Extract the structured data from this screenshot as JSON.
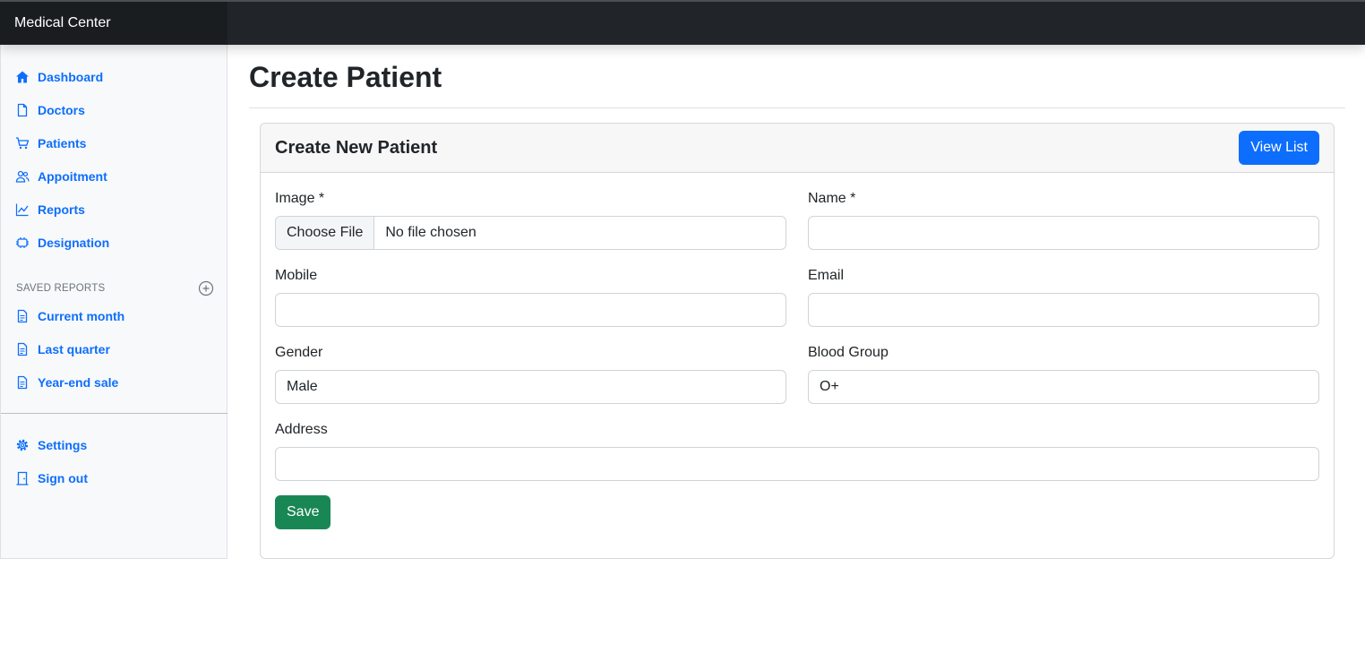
{
  "app": {
    "brand": "Medical Center"
  },
  "sidebar": {
    "items": [
      {
        "label": "Dashboard",
        "icon": "home-icon"
      },
      {
        "label": "Doctors",
        "icon": "file-icon"
      },
      {
        "label": "Patients",
        "icon": "shopping-cart-icon"
      },
      {
        "label": "Appoitment",
        "icon": "users-icon"
      },
      {
        "label": "Reports",
        "icon": "bar-chart-icon"
      },
      {
        "label": "Designation",
        "icon": "layers-icon"
      }
    ],
    "saved_reports_title": "SAVED REPORTS",
    "saved_reports": [
      {
        "label": "Current month",
        "icon": "file-text-icon"
      },
      {
        "label": "Last quarter",
        "icon": "file-text-icon"
      },
      {
        "label": "Year-end sale",
        "icon": "file-text-icon"
      }
    ],
    "footer_items": [
      {
        "label": "Settings",
        "icon": "gear-icon"
      },
      {
        "label": "Sign out",
        "icon": "door-icon"
      }
    ]
  },
  "page": {
    "title": "Create Patient"
  },
  "card": {
    "title": "Create New Patient",
    "view_list_label": "View List",
    "save_label": "Save"
  },
  "form": {
    "image": {
      "label": "Image *",
      "button": "Choose File",
      "status": "No file chosen"
    },
    "name": {
      "label": "Name *",
      "value": ""
    },
    "mobile": {
      "label": "Mobile",
      "value": ""
    },
    "email": {
      "label": "Email",
      "value": ""
    },
    "gender": {
      "label": "Gender",
      "value": "Male"
    },
    "blood_group": {
      "label": "Blood Group",
      "value": "O+"
    },
    "address": {
      "label": "Address",
      "value": ""
    }
  },
  "colors": {
    "primary": "#0d6efd",
    "success": "#198754",
    "topbar": "#212529",
    "sidebar_bg": "#f8f9fa"
  }
}
